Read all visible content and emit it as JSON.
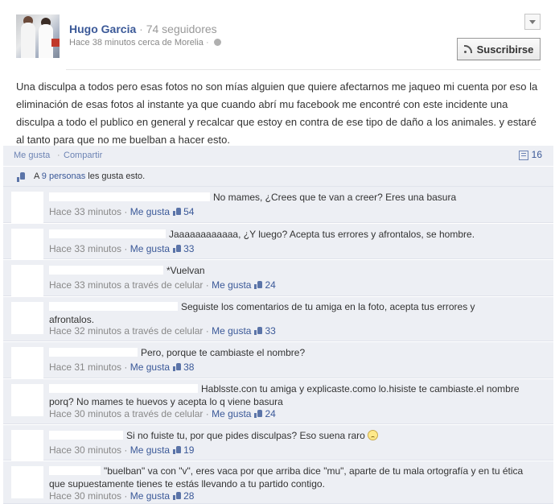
{
  "author": {
    "name": "Hugo Garcia",
    "followers": "74 seguidores",
    "meta": "Hace 38 minutos cerca de Morelia"
  },
  "subscribe_label": "Suscribirse",
  "post_text": "Una disculpa a todos pero esas fotos no son mías alguien que quiere afectarnos me jaqueo mi cuenta por eso la eliminación de esas fotos al instante ya que cuando abrí mu facebook me encontré con este incidente una disculpa a todo el publico en general y recalcar que estoy en contra de ese tipo de daño a los animales. y estaré al tanto para que no me buelban a hacer esto.",
  "actions": {
    "like": "Me gusta",
    "share": "Compartir",
    "comment_count": "16"
  },
  "likes_summary": {
    "prefix": "A ",
    "link": "9 personas",
    "suffix": " les gusta esto."
  },
  "comments": [
    {
      "text": "No mames, ¿Crees que te van a creer? Eres una basura",
      "time": "Hace 33 minutos",
      "via": "",
      "like": "Me gusta",
      "count": "54"
    },
    {
      "text": "Jaaaaaaaaaaaa, ¿Y luego? Acepta tus errores y afrontalos, se hombre.",
      "time": "Hace 33 minutos",
      "via": "",
      "like": "Me gusta",
      "count": "33"
    },
    {
      "text": "*Vuelvan",
      "time": "Hace 33 minutos a través de celular",
      "via": "",
      "like": "Me gusta",
      "count": "24"
    },
    {
      "text": "Seguiste los comentarios de tu amiga en la foto, acepta tus errores y afrontalos.",
      "time": "Hace 32 minutos a través de celular",
      "via": "",
      "like": "Me gusta",
      "count": "33"
    },
    {
      "text": "Pero, porque te cambiaste el nombre?",
      "time": "Hace 31 minutos",
      "via": "",
      "like": "Me gusta",
      "count": "38"
    },
    {
      "text": "Hablsste.con tu amiga y explicaste.como lo.hisiste te cambiaste.el nombre porq? No mames te huevos y acepta lo q viene basura",
      "time": "Hace 30 minutos a través de celular",
      "via": "",
      "like": "Me gusta",
      "count": "24"
    },
    {
      "text": "Si no fuiste tu, por que pides disculpas? Eso suena raro",
      "time": "Hace 30 minutos",
      "via": "",
      "like": "Me gusta",
      "count": "19"
    },
    {
      "text": "\"buelban\" va con \"v\", eres vaca por que arriba dice \"mu\", aparte de tu mala ortografía y en tu ética que supuestamente tienes te estás llevando a tu partido contigo.",
      "time": "Hace 30 minutos",
      "via": "",
      "like": "Me gusta",
      "count": "28"
    }
  ]
}
